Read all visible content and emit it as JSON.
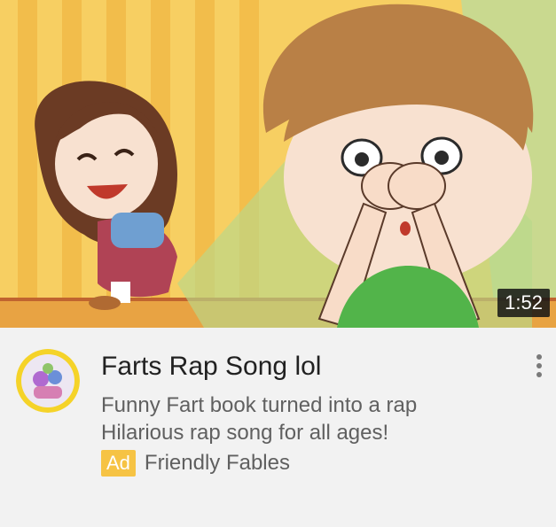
{
  "video": {
    "duration": "1:52",
    "title": "Farts Rap Song lol",
    "description_lines": [
      "Funny Fart book turned into a rap",
      "Hilarious rap song for all ages!"
    ],
    "ad_label": "Ad",
    "channel": "Friendly Fables"
  },
  "icons": {
    "menu": "more-vert-icon",
    "avatar": "channel-avatar"
  },
  "colors": {
    "ad_badge": "#f6c344",
    "title_text": "#212121",
    "secondary_text": "#606060",
    "thumb_background": "#f7cf62"
  }
}
